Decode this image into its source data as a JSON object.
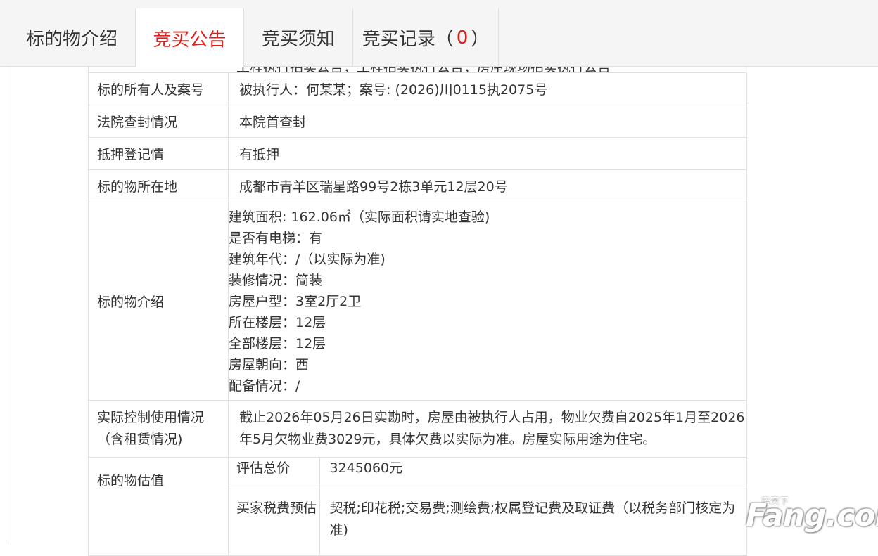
{
  "tabs": [
    {
      "label": "标的物介绍",
      "active": false
    },
    {
      "label": "竞买公告",
      "active": true
    },
    {
      "label": "竞买须知",
      "active": false
    },
    {
      "label": "竞买记录",
      "count": "0",
      "paren_open": "（",
      "paren_close": "）"
    }
  ],
  "accent_color": "#e31d1a",
  "table": {
    "cut_row_text": "工程执行拍卖公告；工程拍卖执行公告；房屋现场拍卖执行公告",
    "rows": [
      {
        "label": "标的所有人及案号",
        "value": "被执行人：何某某；案号: (2026)川0115执2075号"
      },
      {
        "label": "法院查封情况",
        "value": "本院首查封"
      },
      {
        "label": "抵押登记情",
        "value": "有抵押"
      },
      {
        "label": "标的物所在地",
        "value": "成都市青羊区瑞星路99号2栋3单元12层20号"
      }
    ],
    "intro": {
      "label": "标的物介绍",
      "items": [
        "建筑面积: 162.06㎡（实际面积请实地查验)",
        "是否有电梯：有",
        "建筑年代：/（以实际为准)",
        "装修情况：简装",
        "房屋户型：3室2厅2卫",
        "所在楼层：12层",
        "全部楼层：12层",
        "房屋朝向：西",
        "配备情况：/"
      ]
    },
    "control": {
      "label_line1": "实际控制使用情况",
      "label_line2": "（含租赁情况)",
      "value": "截止2026年05月26日实勘时，房屋由被执行人占用，物业欠费自2025年1月至2026年5月欠物业费3029元，具体欠费以实际为准。房屋实际用途为住宅。"
    },
    "valuation": {
      "label": "标的物估值",
      "total_label": "评估总价",
      "total_value": "3245060元",
      "tax_label": "买家税费预估",
      "tax_value": "契税;印花税;交易费;测绘费;权属登记费及取证费（以税务部门核定为准)"
    }
  },
  "watermark": {
    "small": "房天下",
    "big": "Fang.com"
  }
}
